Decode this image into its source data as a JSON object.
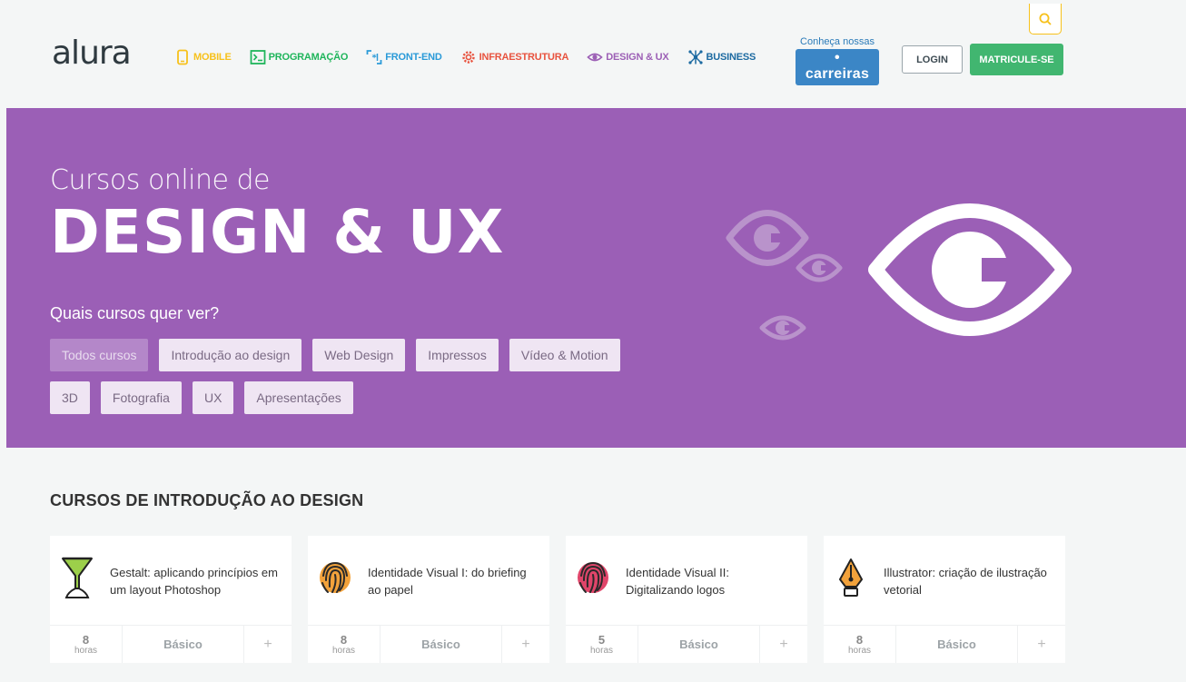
{
  "header": {
    "logo": "alura",
    "nav": [
      {
        "label": "MOBILE",
        "icon": "mobile-icon",
        "color": "#f7c11b"
      },
      {
        "label": "PROGRAMAÇÃO",
        "icon": "terminal-icon",
        "color": "#1fb55b"
      },
      {
        "label": "FRONT-END",
        "icon": "front-end-icon",
        "color": "#2a9ad8"
      },
      {
        "label": "INFRAESTRUTURA",
        "icon": "gear-icon",
        "color": "#e8533f"
      },
      {
        "label": "DESIGN & UX",
        "icon": "eye-icon",
        "color": "#9c5fb5"
      },
      {
        "label": "BUSINESS",
        "icon": "network-icon",
        "color": "#1c6aa1"
      }
    ],
    "careers_top": "Conheça nossas",
    "careers_badge": "carreiras",
    "login": "LOGIN",
    "signup": "MATRICULE-SE"
  },
  "hero": {
    "subtitle": "Cursos online de",
    "title": "DESIGN & UX",
    "question": "Quais cursos quer ver?",
    "filters_row1": [
      "Todos cursos",
      "Introdução ao design",
      "Web Design",
      "Impressos",
      "Vídeo & Motion"
    ],
    "filters_row2": [
      "3D",
      "Fotografia",
      "UX",
      "Apresentações"
    ],
    "active_filter": "Todos cursos",
    "bg_color": "#9b5fb6"
  },
  "section": {
    "title": "CURSOS DE INTRODUÇÃO AO DESIGN",
    "courses": [
      {
        "title": "Gestalt: aplicando princípios em um layout Photoshop",
        "hours": "8",
        "hours_label": "horas",
        "level": "Básico",
        "icon": "goblet-icon"
      },
      {
        "title": "Identidade Visual I: do briefing ao papel",
        "hours": "8",
        "hours_label": "horas",
        "level": "Básico",
        "icon": "fingerprint-icon"
      },
      {
        "title": "Identidade Visual II: Digitalizando logos",
        "hours": "5",
        "hours_label": "horas",
        "level": "Básico",
        "icon": "fingerprint-icon"
      },
      {
        "title": "Illustrator: criação de ilustração vetorial",
        "hours": "8",
        "hours_label": "horas",
        "level": "Básico",
        "icon": "pen-nib-icon"
      }
    ],
    "plus": "+"
  }
}
